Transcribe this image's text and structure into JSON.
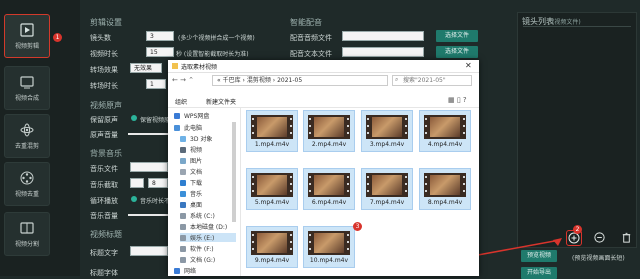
{
  "rail": {
    "items": [
      {
        "label": "视频剪辑",
        "badge": "1"
      },
      {
        "label": "视频合成"
      },
      {
        "label": "去重混剪"
      },
      {
        "label": "视频去重"
      },
      {
        "label": "视频分割"
      }
    ]
  },
  "edit_settings": {
    "title": "剪辑设置",
    "shot_count_label": "镜头数",
    "shot_count_value": "3",
    "shot_count_hint": "(多少个视频拼合成一个视频)",
    "duration_label": "视频时长",
    "duration_value": "15",
    "duration_hint": "秒 (设置智能截取时长为准)",
    "transition_label": "转场效果",
    "transition_value": "无效果",
    "transition_duration_label": "转场时长",
    "transition_duration_value": "1"
  },
  "smart_dub": {
    "title": "智能配音",
    "audio_file_label": "配音音频文件",
    "text_file_label": "配音文本文件",
    "choose_file": "选择文件"
  },
  "original_sound": {
    "title": "视频原声",
    "keep_label": "保留原声",
    "keep_option": "保留视频原声",
    "volume_label": "原声音量"
  },
  "bgm": {
    "title": "背景音乐",
    "file_label": "音乐文件",
    "clip_label": "音乐截取",
    "clip_value": "8",
    "loop_label": "循环播放",
    "loop_option": "音乐时长不足",
    "volume_label": "音乐音量"
  },
  "title_section": {
    "title": "视频标题",
    "text_label": "标题文字",
    "font_label": "标题字体"
  },
  "shot_list": {
    "title": "镜头列表",
    "subtitle": "(视频文件)",
    "badge": "2",
    "preview_button": "预览视频",
    "preview_hint": "(预览视频画面长短)",
    "start_export_button": "开始导出"
  },
  "dialog": {
    "title": "选取素材视频",
    "breadcrumb": [
      "千巴库",
      "混剪视频",
      "2021-05"
    ],
    "search_placeholder": "搜索\"2021-05\"",
    "organize_label": "组织",
    "new_folder_label": "新建文件夹",
    "badge": "3",
    "tree": [
      "WPS网盘",
      "此电脑",
      "3D 对象",
      "视频",
      "图片",
      "文档",
      "下载",
      "音乐",
      "桌面",
      "系统 (C:)",
      "本地磁盘 (D:)",
      "娱乐 (E:)",
      "软件 (F:)",
      "文档 (G:)",
      "网络"
    ],
    "files": [
      "1.mp4.m4v",
      "2.mp4.m4v",
      "3.mp4.m4v",
      "4.mp4.m4v",
      "5.mp4.m4v",
      "6.mp4.m4v",
      "7.mp4.m4v",
      "8.mp4.m4v",
      "9.mp4.m4v",
      "10.mp4.m4v"
    ]
  },
  "colors": {
    "accent": "#1f7a6c",
    "badge": "#d8342c",
    "selection": "#cde5f7"
  }
}
